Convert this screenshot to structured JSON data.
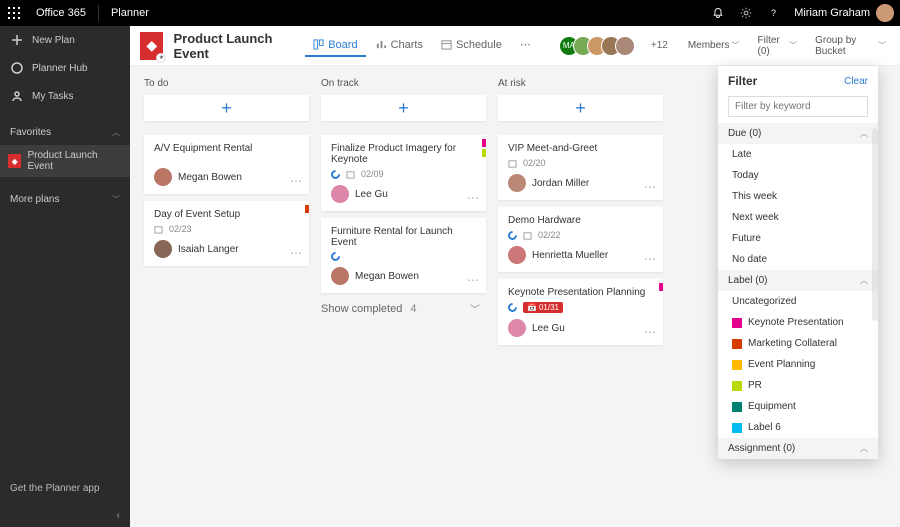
{
  "top": {
    "brand": "Office 365",
    "app": "Planner",
    "user": "Miriam Graham"
  },
  "sidebar": {
    "new_plan": "New Plan",
    "planner_hub": "Planner Hub",
    "my_tasks": "My Tasks",
    "favorites": "Favorites",
    "fav_plan": "Product Launch Event",
    "more_plans": "More plans",
    "get_app": "Get the Planner app"
  },
  "header": {
    "plan_title": "Product Launch Event",
    "tabs": {
      "board": "Board",
      "charts": "Charts",
      "schedule": "Schedule"
    },
    "ma_initials": "MA",
    "more_members": "+12",
    "members": "Members",
    "filter": "Filter (0)",
    "group_by": "Group by Bucket"
  },
  "buckets": {
    "todo": {
      "title": "To do",
      "c1": {
        "title": "A/V Equipment Rental",
        "assignee": "Megan Bowen"
      },
      "c2": {
        "title": "Day of Event Setup",
        "date": "02/23",
        "assignee": "Isaiah Langer"
      }
    },
    "ontrack": {
      "title": "On track",
      "c1": {
        "title": "Finalize Product Imagery for Keynote",
        "date": "02/09",
        "assignee": "Lee Gu"
      },
      "c2": {
        "title": "Furniture Rental for Launch Event",
        "assignee": "Megan Bowen"
      },
      "show_completed": "Show completed",
      "completed_count": "4"
    },
    "atrisk": {
      "title": "At risk",
      "c1": {
        "title": "VIP Meet-and-Greet",
        "date": "02/20",
        "assignee": "Jordan Miller"
      },
      "c2": {
        "title": "Demo Hardware",
        "date": "02/22",
        "assignee": "Henrietta Mueller"
      },
      "c3": {
        "title": "Keynote Presentation Planning",
        "date": "01/31",
        "assignee": "Lee Gu"
      }
    }
  },
  "filter": {
    "title": "Filter",
    "clear": "Clear",
    "placeholder": "Filter by keyword",
    "due_head": "Due (0)",
    "due": {
      "late": "Late",
      "today": "Today",
      "this_week": "This week",
      "next_week": "Next week",
      "future": "Future",
      "no_date": "No date"
    },
    "label_head": "Label (0)",
    "uncat": "Uncategorized",
    "labels": {
      "l1": {
        "name": "Keynote Presentation",
        "color": "#e3008c"
      },
      "l2": {
        "name": "Marketing Collateral",
        "color": "#d83b01"
      },
      "l3": {
        "name": "Event Planning",
        "color": "#ffb900"
      },
      "l4": {
        "name": "PR",
        "color": "#bad80a"
      },
      "l5": {
        "name": "Equipment",
        "color": "#008272"
      },
      "l6": {
        "name": "Label 6",
        "color": "#00bcf2"
      }
    },
    "assignment_head": "Assignment (0)"
  }
}
